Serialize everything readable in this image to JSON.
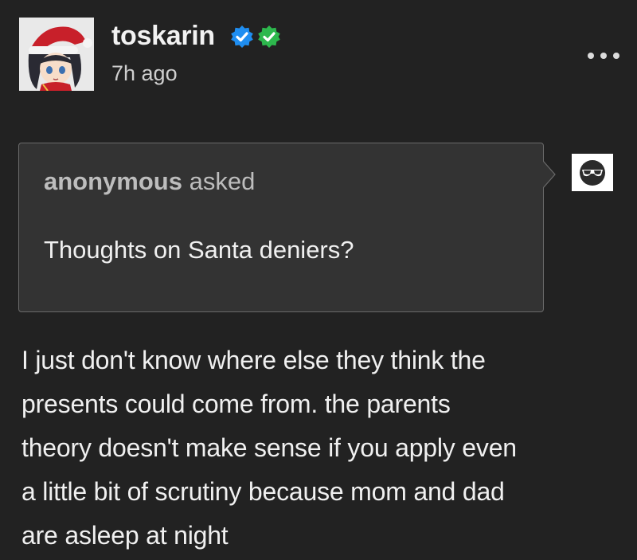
{
  "post": {
    "author": {
      "username": "toskarin",
      "avatar_icon": "anime-santa-avatar",
      "badges": [
        "blue-verified-badge-icon",
        "green-verified-badge-icon"
      ]
    },
    "timestamp": "7h ago",
    "menu_icon": "more-options-icon",
    "ask": {
      "asker": "anonymous",
      "asked_label": "asked",
      "question": "Thoughts on Santa deniers?",
      "asker_avatar_icon": "anonymous-sunglasses-icon"
    },
    "answer_lines": [
      "I just don't know where else they think the",
      "presents could come from. the parents",
      "theory doesn't make sense if you apply even",
      "a little bit of scrutiny because mom and dad",
      "are asleep at night"
    ]
  },
  "colors": {
    "background": "#222222",
    "ask_box": "#333333",
    "blue_badge": "#1f8ef1",
    "green_badge": "#2db84d"
  }
}
